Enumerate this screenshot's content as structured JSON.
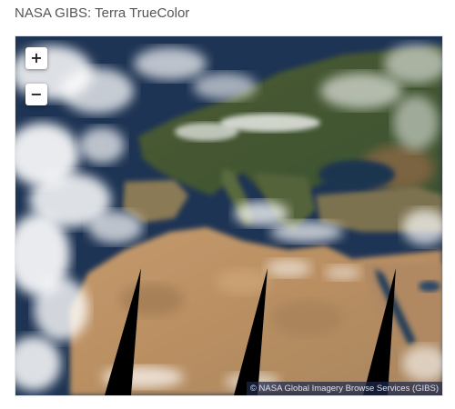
{
  "page": {
    "title": "NASA GIBS: Terra TrueColor"
  },
  "map": {
    "layer": "Terra TrueColor",
    "controls": {
      "zoom_in_label": "+",
      "zoom_out_label": "−"
    },
    "attribution": "© NASA Global Imagery Browse Services (GIBS)"
  }
}
